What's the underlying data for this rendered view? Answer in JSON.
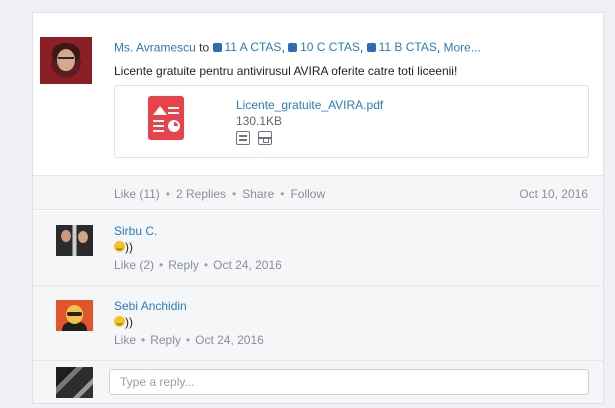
{
  "post": {
    "author": "Ms. Avramescu",
    "to_word": "to",
    "groups": [
      "11 A CTAS",
      "10 C CTAS",
      "11 B CTAS"
    ],
    "more_label": "More...",
    "text": "Licente gratuite pentru antivirusul AVIRA oferite catre toti liceenii!",
    "attachment": {
      "file_name": "Licente_gratuite_AVIRA.pdf",
      "file_size": "130.1KB"
    },
    "footer": {
      "like_label": "Like (11)",
      "replies_label": "2 Replies",
      "share_label": "Share",
      "follow_label": "Follow",
      "date": "Oct 10, 2016"
    }
  },
  "replies": [
    {
      "name": "Sirbu C.",
      "text": "))",
      "like_label": "Like (2)",
      "reply_label": "Reply",
      "date": "Oct 24, 2016"
    },
    {
      "name": "Sebi Anchidin",
      "text": "))",
      "like_label": "Like",
      "reply_label": "Reply",
      "date": "Oct 24, 2016"
    }
  ],
  "reply_box": {
    "placeholder": "Type a reply..."
  },
  "colors": {
    "link": "#2b7bc0",
    "pdf_red": "#e8424a",
    "group_square": "#2b6cb8"
  }
}
